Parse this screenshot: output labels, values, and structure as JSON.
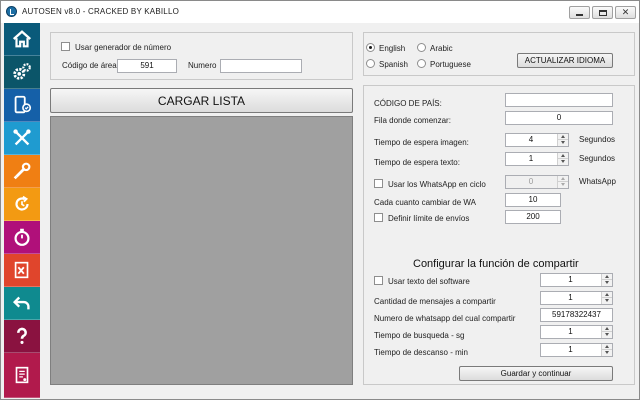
{
  "window": {
    "title": "AUTOSEN v8.0 - CRACKED BY KABILLO"
  },
  "sidebar": {
    "items": [
      {
        "name": "home",
        "color": "#0a5a7a"
      },
      {
        "name": "settings",
        "color": "#0b5569"
      },
      {
        "name": "phone-sync",
        "color": "#1560a8"
      },
      {
        "name": "tools",
        "color": "#1f9bd0"
      },
      {
        "name": "wrench",
        "color": "#f07f13"
      },
      {
        "name": "refresh-time",
        "color": "#f39a12"
      },
      {
        "name": "stopwatch",
        "color": "#b0107a"
      },
      {
        "name": "excel",
        "color": "#e0452c"
      },
      {
        "name": "back",
        "color": "#0f8a8f"
      },
      {
        "name": "help",
        "color": "#8a1240"
      },
      {
        "name": "document",
        "color": "#b11a4c"
      }
    ]
  },
  "generator": {
    "use_generator_label": "Usar generador de número",
    "area_code_label": "Código de área",
    "area_code_value": "591",
    "number_label": "Numero",
    "number_value": ""
  },
  "load_list": {
    "label": "CARGAR LISTA"
  },
  "language": {
    "options": [
      {
        "label": "English",
        "checked": true
      },
      {
        "label": "Arabic",
        "checked": false
      },
      {
        "label": "Spanish",
        "checked": false
      },
      {
        "label": "Portuguese",
        "checked": false
      }
    ],
    "update_label": "ACTUALIZAR IDIOMA"
  },
  "settings": {
    "country_code_label": "CÓDIGO DE PAÍS:",
    "country_code_value": "",
    "start_row_label": "Fila donde comenzar:",
    "start_row_value": "0",
    "image_wait_label": "Tiempo de espera imagen:",
    "image_wait_value": "4",
    "text_wait_label": "Tiempo de espera texto:",
    "text_wait_value": "1",
    "seconds_label": "Segundos",
    "cycle_wa_label": "Usar los WhatsApp en ciclo",
    "cycle_wa_value": "0",
    "whatsapp_label": "WhatsApp",
    "change_wa_label": "Cada cuanto cambiar de WA",
    "change_wa_value": "10",
    "send_limit_label": "Definir límite de envíos",
    "send_limit_value": "200"
  },
  "share": {
    "title": "Configurar la función de compartir",
    "use_software_text_label": "Usar texto del software",
    "use_software_text_value": "1",
    "message_count_label": "Cantidad de mensajes a compartir",
    "message_count_value": "1",
    "share_number_label": "Numero de whatsapp del cual compartir",
    "share_number_value": "59178322437",
    "search_time_label": "Tiempo de busqueda - sg",
    "search_time_value": "1",
    "rest_time_label": "Tiempo de descanso - min",
    "rest_time_value": "1",
    "save_label": "Guardar y continuar"
  }
}
